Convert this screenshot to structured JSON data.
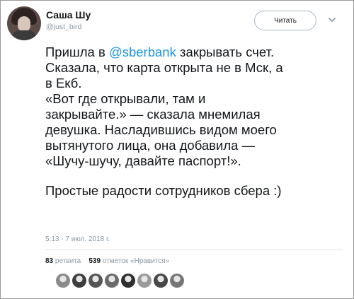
{
  "user": {
    "name": "Саша Шу",
    "handle": "@just_bird"
  },
  "follow_button": {
    "label": "Читать"
  },
  "tweet": {
    "line1_pre": "Пришла в ",
    "mention": "@sberbank",
    "line1_post": " закрывать счет.",
    "line2": "Сказала, что карта открыта не в Мск, а",
    "line3": "в Екб.",
    "line4": "«Вот где открывали, там и",
    "line5": "закрывайте.» — сказала мнемилая",
    "line6": "девушка. Насладившись видом моего",
    "line7": "вытянутого лица, она добавила —",
    "line8": "«Шучу-шучу, давайте паспорт!».",
    "line9": "Простые радости сотрудников сбера :)"
  },
  "timestamp": "5:13 - 7 июл. 2018 г.",
  "stats": {
    "retweets_count": "83",
    "retweets_label": "ретвита",
    "likes_count": "539",
    "likes_label": "отметок «Нравится»"
  },
  "likers": [
    {
      "icon": "liker-avatar-1",
      "color": "#8a8a8a"
    },
    {
      "icon": "liker-avatar-2",
      "color": "#3d3d3d"
    },
    {
      "icon": "liker-avatar-3",
      "color": "#555555"
    },
    {
      "icon": "liker-avatar-4",
      "color": "#6b6b6b"
    },
    {
      "icon": "liker-avatar-5",
      "color": "#2f2f2f"
    },
    {
      "icon": "liker-avatar-6",
      "color": "#9a9a9a"
    },
    {
      "icon": "liker-avatar-7",
      "color": "#474747"
    },
    {
      "icon": "liker-avatar-8",
      "color": "#777777"
    }
  ],
  "colors": {
    "mention": "#1b95e0",
    "secondary_text": "#8899a6",
    "primary_text": "#14171a"
  }
}
